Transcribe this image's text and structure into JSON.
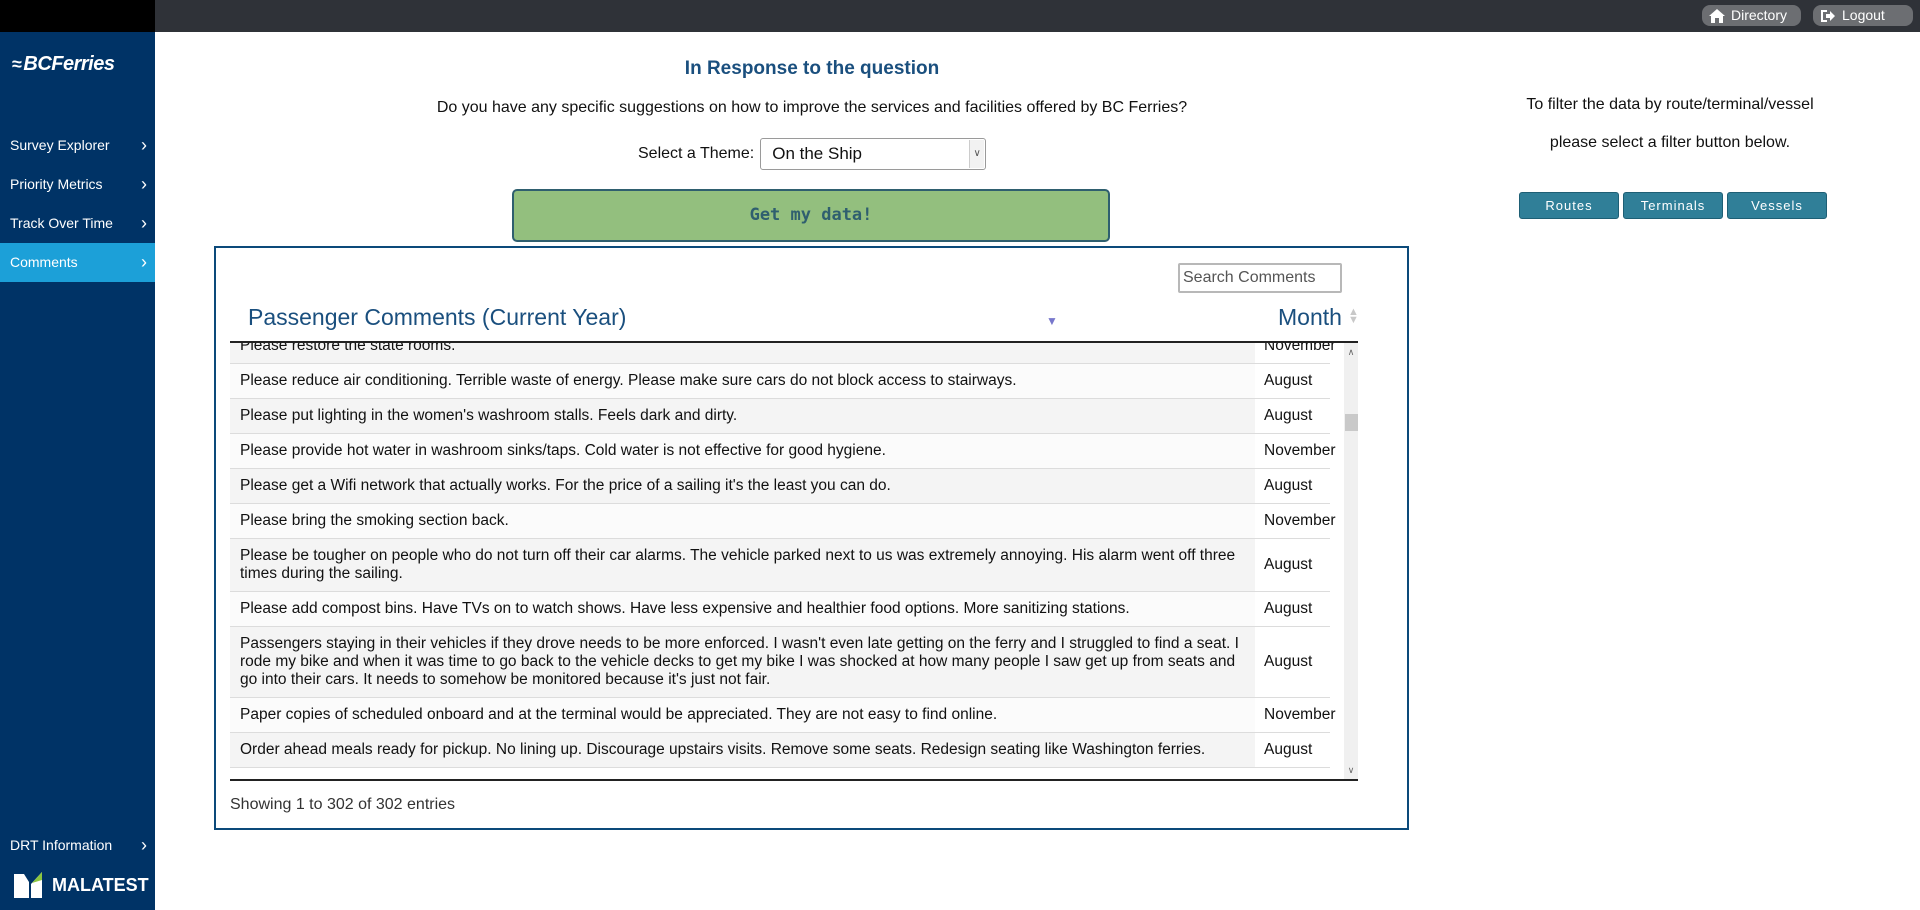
{
  "topbar": {
    "directory_label": "Directory",
    "logout_label": "Logout",
    "directory_icon": "home-icon",
    "logout_icon": "logout-icon"
  },
  "sidebar": {
    "logo_text": "BCFerries",
    "items": [
      {
        "label": "Survey Explorer",
        "active": false
      },
      {
        "label": "Priority Metrics",
        "active": false
      },
      {
        "label": "Track Over Time",
        "active": false
      },
      {
        "label": "Comments",
        "active": true
      }
    ],
    "bottom_item": {
      "label": "DRT Information"
    },
    "footer_logo": "MALATEST"
  },
  "main": {
    "title": "In Response to the question",
    "question": "Do you have any specific suggestions on how to improve the services and facilities offered by BC Ferries?",
    "theme_label": "Select a Theme:",
    "theme_value": "On the Ship",
    "get_data_label": "Get my data!"
  },
  "filter": {
    "line1": "To filter the data by route/terminal/vessel",
    "line2": "please select a filter button below.",
    "buttons": [
      "Routes",
      "Terminals",
      "Vessels"
    ]
  },
  "comments_table": {
    "search_placeholder": "Search Comments",
    "columns": [
      "Passenger Comments (Current Year)",
      "Month"
    ],
    "rows": [
      {
        "comment": "Please restore the state rooms.",
        "month": "November"
      },
      {
        "comment": "Please reduce air conditioning. Terrible waste of energy. Please make sure cars do not block access to stairways.",
        "month": "August"
      },
      {
        "comment": "Please put lighting in the women's washroom stalls. Feels dark and dirty.",
        "month": "August"
      },
      {
        "comment": "Please provide hot water in washroom sinks/taps. Cold water is not effective for good hygiene.",
        "month": "November"
      },
      {
        "comment": "Please get a Wifi network that actually works. For the price of a sailing it's the least you can do.",
        "month": "August"
      },
      {
        "comment": "Please bring the smoking section back.",
        "month": "November"
      },
      {
        "comment": "Please be tougher on people who do not turn off their car alarms. The vehicle parked next to us was extremely annoying. His alarm went off three times during the sailing.",
        "month": "August"
      },
      {
        "comment": "Please add compost bins. Have TVs on to watch shows. Have less expensive and healthier food options. More sanitizing stations.",
        "month": "August"
      },
      {
        "comment": "Passengers staying in their vehicles if they drove needs to be more enforced. I wasn't even late getting on the ferry and I struggled to find a seat. I rode my bike and when it was time to go back to the vehicle decks to get my bike I was shocked at how many people I saw get up from seats and go into their cars. It needs to somehow be monitored because it's just not fair.",
        "month": "August"
      },
      {
        "comment": "Paper copies of scheduled onboard and at the terminal would be appreciated. They are not easy to find online.",
        "month": "November"
      },
      {
        "comment": "Order ahead meals ready for pickup. No lining up. Discourage upstairs visits. Remove some seats. Redesign seating like Washington ferries.",
        "month": "August"
      }
    ],
    "info": "Showing 1 to 302 of 302 entries"
  },
  "colors": {
    "sidebar_bg": "#003366",
    "sidebar_active": "#1ca0d8",
    "title_blue": "#1a4f7e",
    "get_data_green": "#93bf7e",
    "filter_button": "#307f98"
  }
}
